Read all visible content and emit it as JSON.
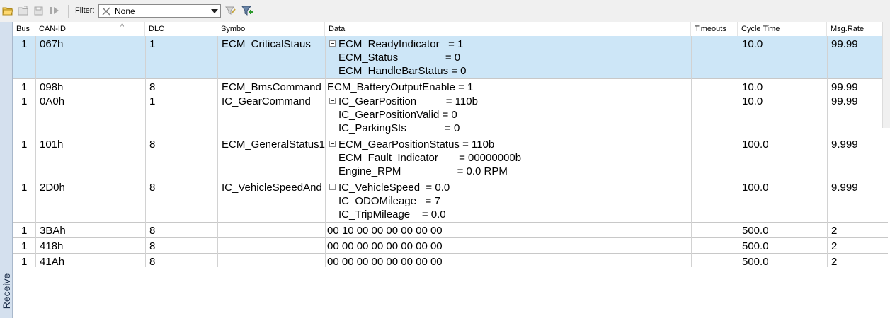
{
  "toolbar": {
    "filter_label": "Filter:",
    "filter_value": "None"
  },
  "sidebar": {
    "label": "Receive"
  },
  "columns": [
    "Bus",
    "CAN-ID",
    "DLC",
    "Symbol",
    "Data",
    "Timeouts",
    "Cycle Time",
    "Msg.Rate"
  ],
  "rows": [
    {
      "bus": "1",
      "id": "067h",
      "dlc": "1",
      "symbol": "ECM_CriticalStaus",
      "expandable": true,
      "data": [
        "ECM_ReadyIndicator   = 1",
        "ECM_Status                = 0",
        "ECM_HandleBarStatus = 0"
      ],
      "timeouts": "",
      "cycle": "10.0",
      "rate": "99.99",
      "selected": true
    },
    {
      "bus": "1",
      "id": "098h",
      "dlc": "8",
      "symbol": "ECM_BmsCommand",
      "expandable": false,
      "data": [
        "ECM_BatteryOutputEnable = 1"
      ],
      "timeouts": "",
      "cycle": "10.0",
      "rate": "99.99",
      "selected": false
    },
    {
      "bus": "1",
      "id": "0A0h",
      "dlc": "1",
      "symbol": "IC_GearCommand",
      "expandable": true,
      "data": [
        "IC_GearPosition          = 110b",
        "IC_GearPositionValid = 0",
        "IC_ParkingSts             = 0"
      ],
      "timeouts": "",
      "cycle": "10.0",
      "rate": "99.99",
      "selected": false
    },
    {
      "bus": "1",
      "id": "101h",
      "dlc": "8",
      "symbol": "ECM_GeneralStatus1",
      "expandable": true,
      "data": [
        "ECM_GearPositionStatus = 110b",
        "ECM_Fault_Indicator       = 00000000b",
        "Engine_RPM                   = 0.0 RPM"
      ],
      "timeouts": "",
      "cycle": "100.0",
      "rate": "9.999",
      "selected": false
    },
    {
      "bus": "1",
      "id": "2D0h",
      "dlc": "8",
      "symbol": "IC_VehicleSpeedAnd",
      "expandable": true,
      "data": [
        "IC_VehicleSpeed  = 0.0",
        "IC_ODOMileage   = 7",
        "IC_TripMileage    = 0.0"
      ],
      "timeouts": "",
      "cycle": "100.0",
      "rate": "9.999",
      "selected": false
    },
    {
      "bus": "1",
      "id": "3BAh",
      "dlc": "8",
      "symbol": "",
      "expandable": false,
      "data": [
        "00 10 00 00 00 00 00 00"
      ],
      "timeouts": "",
      "cycle": "500.0",
      "rate": "2",
      "selected": false
    },
    {
      "bus": "1",
      "id": "418h",
      "dlc": "8",
      "symbol": "",
      "expandable": false,
      "data": [
        "00 00 00 00 00 00 00 00"
      ],
      "timeouts": "",
      "cycle": "500.0",
      "rate": "2",
      "selected": false
    },
    {
      "bus": "1",
      "id": "41Ah",
      "dlc": "8",
      "symbol": "",
      "expandable": false,
      "data": [
        "00 00 00 00 00 00 00 00"
      ],
      "timeouts": "",
      "cycle": "500.0",
      "rate": "2",
      "selected": false
    }
  ]
}
